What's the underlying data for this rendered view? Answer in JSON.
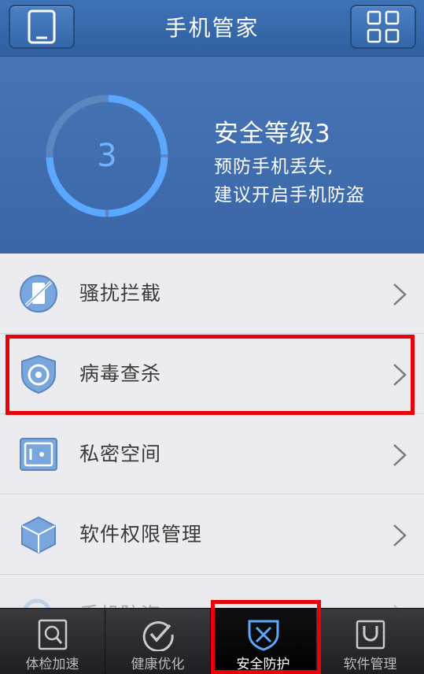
{
  "header": {
    "title": "手机管家",
    "left_icon": "phone-icon",
    "right_icon": "grid-menu-icon"
  },
  "hero": {
    "score": "3",
    "title": "安全等级3",
    "line1": "预防手机丢失,",
    "line2": "建议开启手机防盗",
    "ring_color": "#5aa8ff"
  },
  "list": {
    "items": [
      {
        "label": "骚扰拦截",
        "icon": "phone-block-icon"
      },
      {
        "label": "病毒查杀",
        "icon": "shield-target-icon"
      },
      {
        "label": "私密空间",
        "icon": "safe-icon"
      },
      {
        "label": "软件权限管理",
        "icon": "cube-icon"
      },
      {
        "label": "手机防盗",
        "icon": "search-icon"
      }
    ]
  },
  "tabs": [
    {
      "label": "体检加速",
      "icon": "magnifier-icon"
    },
    {
      "label": "健康优化",
      "icon": "check-circle-icon"
    },
    {
      "label": "安全防护",
      "icon": "shield-icon",
      "active": true
    },
    {
      "label": "软件管理",
      "icon": "bag-icon"
    }
  ],
  "colors": {
    "accent": "#3a66a8",
    "highlight": "#e8000a"
  }
}
